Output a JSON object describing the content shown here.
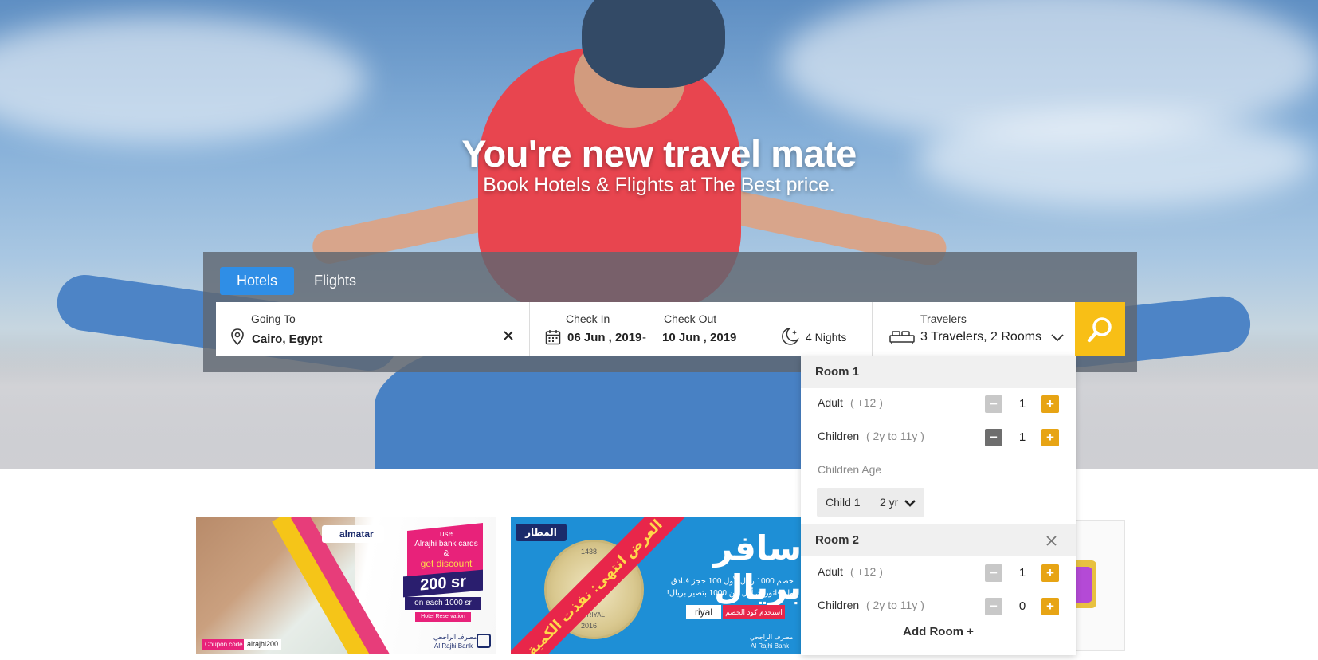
{
  "hero": {
    "title": "You're new travel mate",
    "subtitle": "Book Hotels & Flights at The Best price."
  },
  "tabs": [
    {
      "label": "Hotels",
      "active": true
    },
    {
      "label": "Flights",
      "active": false
    }
  ],
  "search": {
    "destination_label": "Going To",
    "destination_value": "Cairo, Egypt",
    "checkin_label": "Check In",
    "checkin_value": "06 Jun , 2019",
    "date_separator": "-",
    "checkout_label": "Check Out",
    "checkout_value": "10 Jun , 2019",
    "nights": "4 Nights",
    "travelers_label": "Travelers",
    "travelers_value": "3 Travelers, 2 Rooms"
  },
  "rooms_dropdown": {
    "rooms": [
      {
        "title": "Room 1",
        "adult_label": "Adult",
        "adult_hint": "( +12 )",
        "adult_count": "1",
        "children_label": "Children",
        "children_hint": "( 2y to 11y )",
        "children_count": "1",
        "children_age_label": "Children Age",
        "child_ages": [
          {
            "label": "Child 1",
            "value": "2 yr"
          }
        ]
      },
      {
        "title": "Room 2",
        "adult_label": "Adult",
        "adult_hint": "( +12 )",
        "adult_count": "1",
        "children_label": "Children",
        "children_hint": "( 2y to 11y )",
        "children_count": "0"
      }
    ],
    "add_room": "Add Room +"
  },
  "promos": [
    {
      "brand": "almatar",
      "line1": "use",
      "line2": "Alrajhi bank cards",
      "line3": "&",
      "line4": "get discount",
      "amount": "200 sr",
      "line5": "on each 1000 sr",
      "line6": "Hotel Reservation",
      "coupon_label": "Coupon code",
      "coupon_code": "alrajhi200",
      "bank_ar": "مصرف الراجحي",
      "bank_en": "Al Rajhi Bank"
    },
    {
      "brand_ar": "المطار",
      "headline": "سافر بريال",
      "ribbon": "العرض انتهى: نفذت الكمية",
      "desc1": "خصم 1000 ريال لأول 100 حجز فنادق",
      "desc2": "ولو فاتورتك أقل من 1000 بتصير بريال!",
      "code_label": "riyal",
      "code_hint": "استخدم كود الخصم",
      "coin_top": "1438",
      "coin_text": "ONE RIYAL",
      "coin_bottom": "2016",
      "bank_ar": "مصرف الراجحي",
      "bank_en": "Al Rajhi Bank"
    }
  ],
  "colors": {
    "tab_active": "#2f8ee6",
    "search_button": "#f8bf16",
    "plus_button": "#e7a414"
  }
}
